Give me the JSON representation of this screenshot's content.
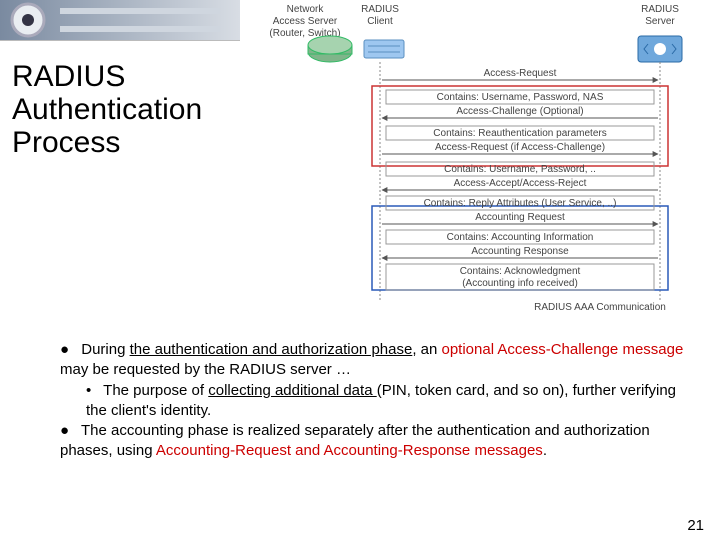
{
  "title": "RADIUS Authentication Process",
  "page_number": "21",
  "diagram": {
    "nas_label_line1": "Network",
    "nas_label_line2": "Access Server",
    "nas_label_line3": "(Router, Switch)",
    "client_label_line1": "RADIUS",
    "client_label_line2": "Client",
    "server_label_line1": "RADIUS",
    "server_label_line2": "Server",
    "caption": "RADIUS AAA Communication",
    "msg1": "Access-Request",
    "msg1c": "Contains: Username, Password, NAS",
    "msg2": "Access-Challenge (Optional)",
    "msg2c": "Contains: Reauthentication parameters",
    "msg3": "Access-Request (if Access-Challenge)",
    "msg3c": "Contains: Username, Password, ..",
    "msg4": "Access-Accept/Access-Reject",
    "msg4c": "Contains: Reply Attributes (User Service, ..)",
    "msg5": "Accounting Request",
    "msg5c": "Contains: Accounting Information",
    "msg6": "Accounting Response",
    "msg6c": "Contains: Acknowledgment",
    "msg6c2": "(Accounting info received)"
  },
  "bullets": {
    "b1_pre": "During ",
    "b1_u1": "the authentication and authorization phase",
    "b1_mid": ", an ",
    "b1_red": "optional Access-Challenge message",
    "b1_post": " may be requested by the RADIUS server …",
    "b2_pre": "The purpose of ",
    "b2_u": "collecting additional data ",
    "b2_post": "(PIN, token card, and so on), further verifying the client's identity.",
    "b3_pre": "The accounting phase is realized separately after the authentication and authorization phases, using ",
    "b3_red": "Accounting-Request and Accounting-Response messages",
    "b3_post": "."
  }
}
